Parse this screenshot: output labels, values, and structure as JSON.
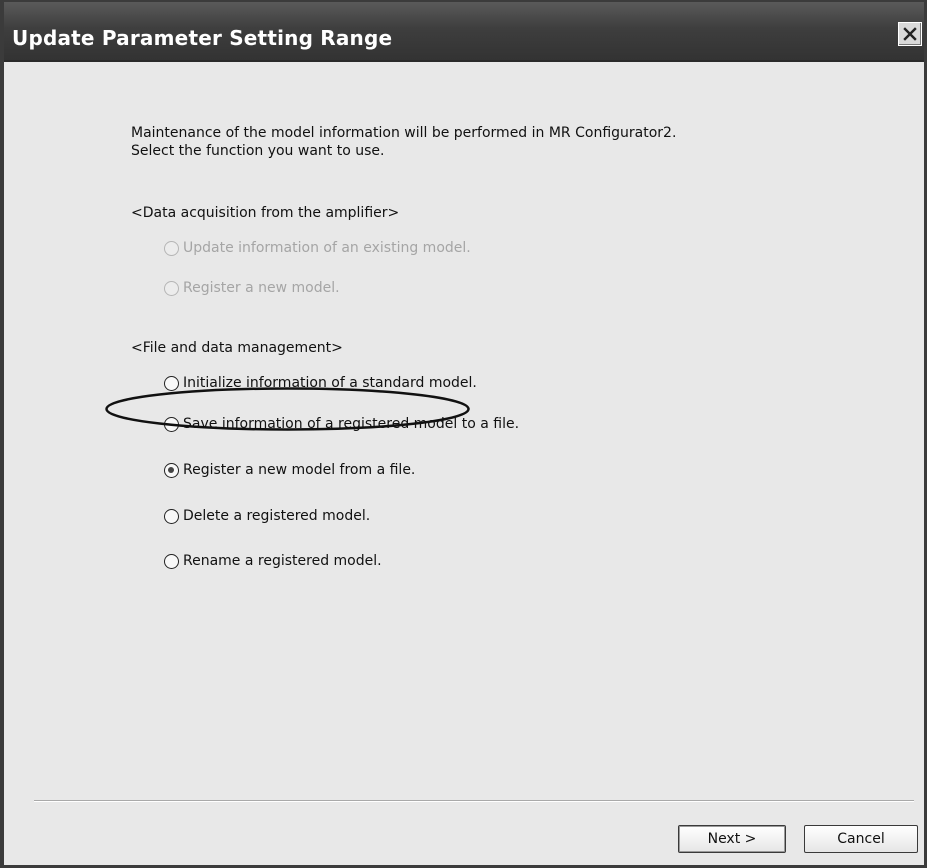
{
  "window": {
    "title": "Update Parameter Setting Range"
  },
  "intro": {
    "line1": "Maintenance of the model information will be performed in MR Configurator2.",
    "line2": "Select the function you want to use."
  },
  "sections": {
    "acquisition": {
      "label": "<Data acquisition from the amplifier>",
      "options": [
        {
          "label": "Update information of an existing model.",
          "enabled": false,
          "selected": false
        },
        {
          "label": "Register a new model.",
          "enabled": false,
          "selected": false
        }
      ]
    },
    "file_management": {
      "label": "<File and data management>",
      "options": [
        {
          "label": "Initialize information of a standard model.",
          "enabled": true,
          "selected": false
        },
        {
          "label": "Save information of a registered model to a file.",
          "enabled": true,
          "selected": false
        },
        {
          "label": "Register a new model from a file.",
          "enabled": true,
          "selected": true
        },
        {
          "label": "Delete a registered model.",
          "enabled": true,
          "selected": false
        },
        {
          "label": "Rename a registered model.",
          "enabled": true,
          "selected": false
        }
      ]
    }
  },
  "buttons": {
    "next": "Next >",
    "cancel": "Cancel"
  },
  "icons": {
    "close": "close-icon"
  },
  "colors": {
    "titlebar": "#3e3e3e",
    "background": "#e8e8e8",
    "disabled_text": "#a5a5a5"
  }
}
